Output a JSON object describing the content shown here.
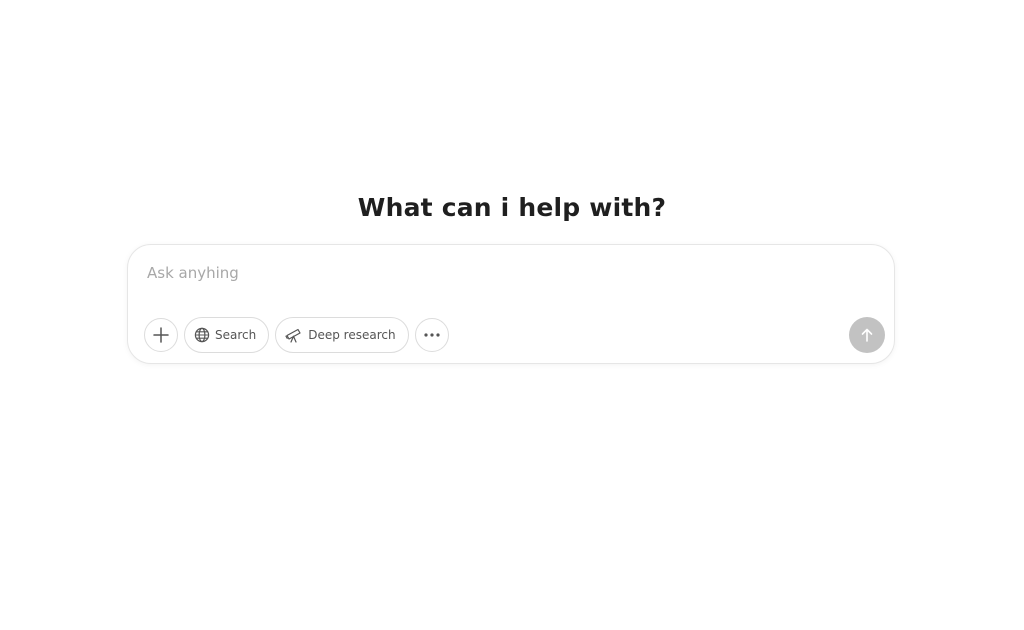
{
  "main": {
    "heading": "What can i help with?"
  },
  "composer": {
    "placeholder": "Ask anyhing",
    "tools": {
      "add_icon": "plus-icon",
      "search_label": "Search",
      "search_icon": "globe-icon",
      "deep_research_label": "Deep research",
      "deep_research_icon": "telescope-icon",
      "more_icon": "more-icon"
    },
    "send_icon": "arrow-up-icon"
  },
  "colors": {
    "background": "#ffffff",
    "heading": "#1f1f1f",
    "placeholder": "#a8a8a8",
    "border": "#dcdcdc",
    "send_button_disabled": "#c2c2c2"
  }
}
